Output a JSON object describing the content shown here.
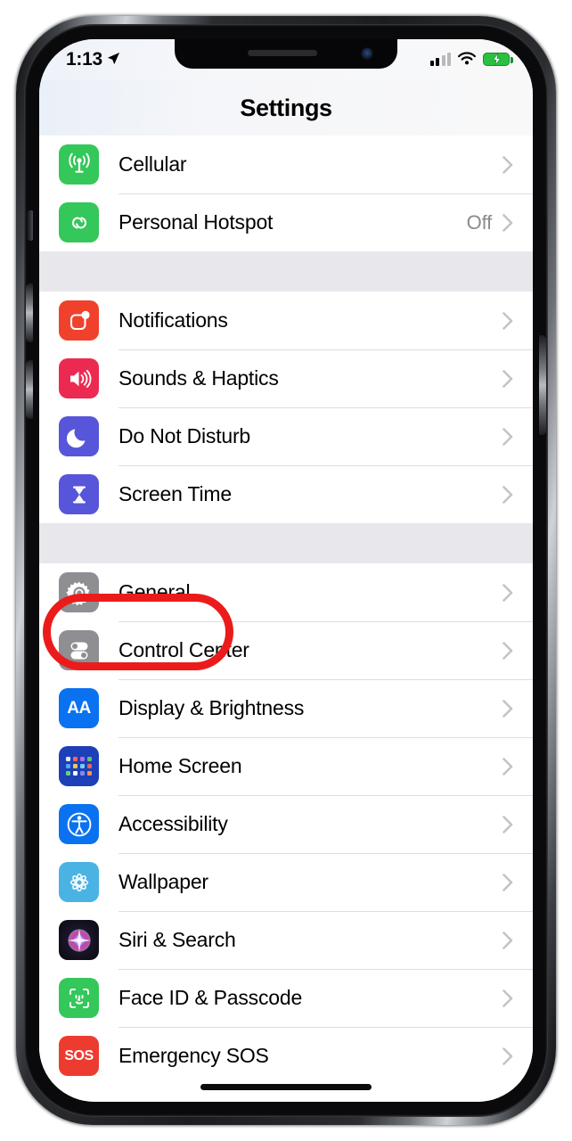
{
  "status_bar": {
    "time": "1:13",
    "location_icon": "location-arrow-icon",
    "cellular_icon": "cellular-signal-icon",
    "cellular_bars_filled": 2,
    "cellular_bars_total": 4,
    "wifi_icon": "wifi-icon",
    "battery_icon": "battery-charging-icon",
    "battery_charging": true
  },
  "header": {
    "title": "Settings"
  },
  "groups": [
    {
      "id": "connectivity",
      "rows": [
        {
          "label": "Cellular",
          "icon": "cellular-antenna-icon",
          "icon_class": "ic-cellular",
          "value": "",
          "chevron": true
        },
        {
          "label": "Personal Hotspot",
          "icon": "hotspot-link-icon",
          "icon_class": "ic-hotspot",
          "value": "Off",
          "chevron": true
        }
      ]
    },
    {
      "id": "alerts",
      "rows": [
        {
          "label": "Notifications",
          "icon": "notifications-badge-icon",
          "icon_class": "ic-notif",
          "value": "",
          "chevron": true
        },
        {
          "label": "Sounds & Haptics",
          "icon": "speaker-waves-icon",
          "icon_class": "ic-sounds",
          "value": "",
          "chevron": true
        },
        {
          "label": "Do Not Disturb",
          "icon": "crescent-moon-icon",
          "icon_class": "ic-dnd",
          "value": "",
          "chevron": true
        },
        {
          "label": "Screen Time",
          "icon": "hourglass-icon",
          "icon_class": "ic-screentime",
          "value": "",
          "chevron": true
        }
      ]
    },
    {
      "id": "system",
      "rows": [
        {
          "label": "General",
          "icon": "gear-icon",
          "icon_class": "ic-general",
          "value": "",
          "chevron": true,
          "highlighted": true
        },
        {
          "label": "Control Center",
          "icon": "toggles-icon",
          "icon_class": "ic-control",
          "value": "",
          "chevron": true
        },
        {
          "label": "Display & Brightness",
          "icon": "text-size-aa-icon",
          "icon_class": "ic-display",
          "value": "",
          "chevron": true
        },
        {
          "label": "Home Screen",
          "icon": "app-grid-icon",
          "icon_class": "ic-home",
          "value": "",
          "chevron": true
        },
        {
          "label": "Accessibility",
          "icon": "accessibility-icon",
          "icon_class": "ic-access",
          "value": "",
          "chevron": true
        },
        {
          "label": "Wallpaper",
          "icon": "flower-icon",
          "icon_class": "ic-wallpaper",
          "value": "",
          "chevron": true
        },
        {
          "label": "Siri & Search",
          "icon": "siri-orb-icon",
          "icon_class": "ic-siri",
          "value": "",
          "chevron": true
        },
        {
          "label": "Face ID & Passcode",
          "icon": "face-id-icon",
          "icon_class": "ic-faceid",
          "value": "",
          "chevron": true
        },
        {
          "label": "Emergency SOS",
          "icon": "sos-icon",
          "icon_class": "ic-sos",
          "value": "",
          "chevron": true
        }
      ]
    }
  ],
  "annotation": {
    "type": "ellipse-highlight",
    "target_label": "General",
    "color": "#ec1b1b"
  },
  "home_indicator": {
    "present": true
  },
  "device": {
    "frame": "iphone-x-style",
    "notch": true
  }
}
